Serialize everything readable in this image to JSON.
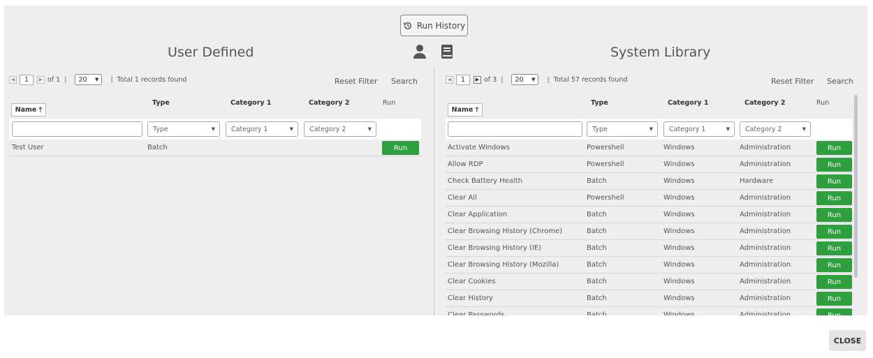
{
  "run_history": {
    "label": "Run History",
    "icon": "history-icon"
  },
  "user_defined": {
    "title": "User Defined",
    "pager": {
      "page": "1",
      "of_label": "of 1",
      "page_size": "20",
      "total": "Total 1 records found"
    },
    "reset_filter": "Reset Filter",
    "search": "Search",
    "columns": {
      "name": "Name",
      "type": "Type",
      "cat1": "Category 1",
      "cat2": "Category 2",
      "run": "Run"
    },
    "filters": {
      "type": "Type",
      "cat1": "Category 1",
      "cat2": "Category 2"
    },
    "rows": [
      {
        "name": "Test User",
        "type": "Batch",
        "cat1": "",
        "cat2": "",
        "run": "Run"
      }
    ]
  },
  "system_library": {
    "title": "System Library",
    "pager": {
      "page": "1",
      "of_label": "of 3",
      "page_size": "20",
      "total": "Total 57 records found"
    },
    "reset_filter": "Reset Filter",
    "search": "Search",
    "columns": {
      "name": "Name",
      "type": "Type",
      "cat1": "Category 1",
      "cat2": "Category 2",
      "run": "Run"
    },
    "filters": {
      "type": "Type",
      "cat1": "Category 1",
      "cat2": "Category 2"
    },
    "rows": [
      {
        "name": "Activate Windows",
        "type": "Powershell",
        "cat1": "Windows",
        "cat2": "Administration",
        "run": "Run"
      },
      {
        "name": "Allow RDP",
        "type": "Powershell",
        "cat1": "Windows",
        "cat2": "Administration",
        "run": "Run"
      },
      {
        "name": "Check Battery Health",
        "type": "Batch",
        "cat1": "Windows",
        "cat2": "Hardware",
        "run": "Run"
      },
      {
        "name": "Clear All",
        "type": "Powershell",
        "cat1": "Windows",
        "cat2": "Administration",
        "run": "Run"
      },
      {
        "name": "Clear Application",
        "type": "Batch",
        "cat1": "Windows",
        "cat2": "Administration",
        "run": "Run"
      },
      {
        "name": "Clear Browsing History (Chrome)",
        "type": "Batch",
        "cat1": "Windows",
        "cat2": "Administration",
        "run": "Run"
      },
      {
        "name": "Clear Browsing History (IE)",
        "type": "Batch",
        "cat1": "Windows",
        "cat2": "Administration",
        "run": "Run"
      },
      {
        "name": "Clear Browsing History (Mozilla)",
        "type": "Batch",
        "cat1": "Windows",
        "cat2": "Administration",
        "run": "Run"
      },
      {
        "name": "Clear Cookies",
        "type": "Batch",
        "cat1": "Windows",
        "cat2": "Administration",
        "run": "Run"
      },
      {
        "name": "Clear History",
        "type": "Batch",
        "cat1": "Windows",
        "cat2": "Administration",
        "run": "Run"
      },
      {
        "name": "Clear Passwords",
        "type": "Batch",
        "cat1": "Windows",
        "cat2": "Administration",
        "run": "Run"
      }
    ]
  },
  "close_label": "CLOSE",
  "colors": {
    "run_button": "#2e9e3e",
    "panel_bg": "#eeeeee"
  }
}
